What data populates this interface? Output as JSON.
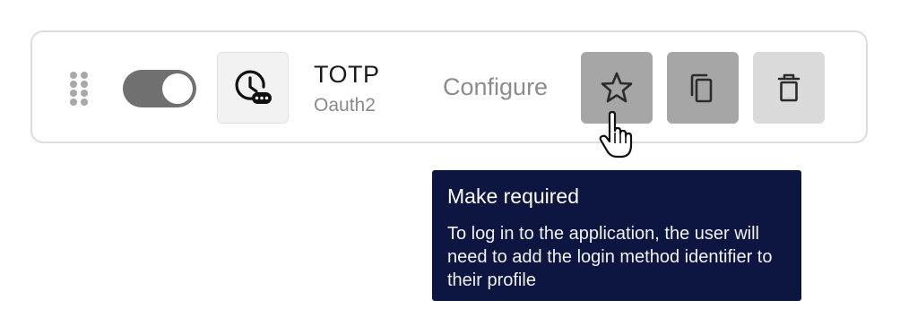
{
  "method": {
    "title": "TOTP",
    "subtitle": "Oauth2",
    "icon": "clock-with-password-icon",
    "enabled": true
  },
  "actions": {
    "configure_label": "Configure",
    "make_required_icon": "star-icon",
    "duplicate_icon": "copy-icon",
    "delete_icon": "trash-icon"
  },
  "tooltip": {
    "title": "Make required",
    "body": "To log in to the application, the user will need to add the login method identifier to their profile"
  },
  "colors": {
    "tooltip_bg": "#0d1640",
    "toggle_on": "#707070",
    "action_button": "#a6a6a6",
    "delete_button": "#dadada"
  }
}
